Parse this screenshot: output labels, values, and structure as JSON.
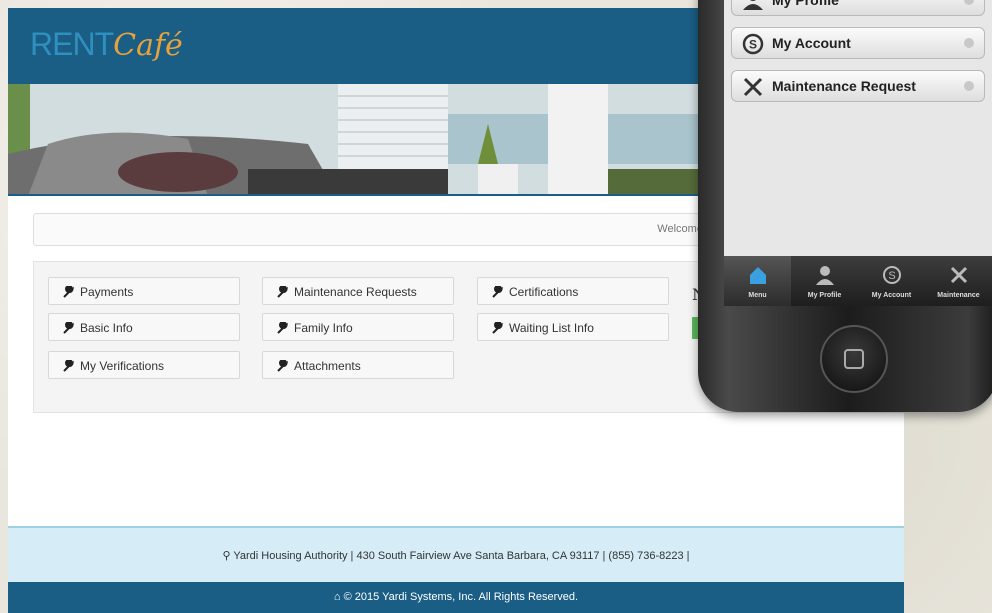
{
  "brand": {
    "rent": "RENT",
    "cafe": "Café"
  },
  "welcome": "Welcome, Mar",
  "menu": [
    [
      "Payments",
      "Maintenance Requests",
      "Certifications"
    ],
    [
      "Basic Info",
      "Family Info",
      "Waiting List Info"
    ],
    [
      "My Verifications",
      "Attachments"
    ]
  ],
  "side_heading_glyph": "N",
  "footer": {
    "address_line": "Yardi Housing Authority  |  430 South Fairview Ave Santa Barbara, CA 93117  |  (855) 736-8223  |",
    "copyright": "© 2015 Yardi Systems, Inc. All Rights Reserved."
  },
  "phone": {
    "rows": [
      "My Profile",
      "My Account",
      "Maintenance Request"
    ],
    "tabs": [
      "Menu",
      "My Profile",
      "My Account",
      "Maintenance"
    ]
  },
  "colors": {
    "header": "#1a5d85",
    "address_bg": "#d6edf7",
    "accent_green": "#5cb85c"
  }
}
